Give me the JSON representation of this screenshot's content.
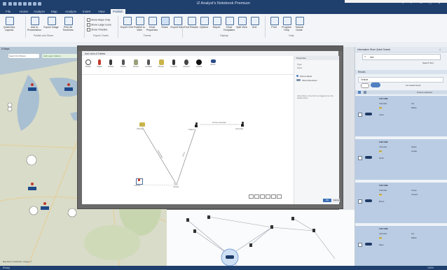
{
  "window": {
    "title": "i2 Analyst's Notebook Premium"
  },
  "menu": {
    "tabs": [
      "File",
      "Home",
      "Analyze",
      "Map",
      "Analyze",
      "Insert",
      "View",
      "Publish"
    ],
    "active_index": 7
  },
  "ribbon": {
    "groups": [
      "Analysis",
      "Publish and Share",
      "Export Charts",
      "Theme",
      "Display",
      "Help"
    ],
    "buttons": [
      "Quickview Layouts",
      "Add to Presentation",
      "Export Image",
      "Print All Timelines",
      "Export Grid",
      "Publish to Web",
      "Chart Properties",
      "Share",
      "Export Data",
      "Find Results",
      "Options",
      "Report",
      "Chart Templates",
      "Split View",
      "Grid",
      "Print",
      "Program Help",
      "Tutorial Guide"
    ],
    "checkboxes": [
      "Show Maps Only",
      "Show Large Icons",
      "Show Timeline"
    ]
  },
  "map": {
    "title": "i2 Maps",
    "search_label": "Search for Places",
    "layer_label": "Add Layer Options",
    "attribution": "Map data © contributors, Imagery ©"
  },
  "dialog": {
    "tabs": [
      "Add Links & Entities"
    ],
    "palette": [
      "Person",
      "Object",
      "Vehicle",
      "Phone",
      "Person",
      "Location",
      "Person",
      "Location",
      "Account",
      "Vehicle",
      "Event"
    ],
    "nodes": [
      {
        "label": "Vehicle"
      },
      {
        "label": "Subject"
      },
      {
        "label": "Associate"
      },
      {
        "label": "Address"
      },
      {
        "label": "Location"
      }
    ],
    "link_labels": [
      "Associated",
      "Drove",
      "Known Associate"
    ],
    "props": {
      "header": "Properties",
      "field1": "Type",
      "field2": "Card",
      "opt1": "Show Labels",
      "opt2": "Show Directions",
      "help_text": "Add entities to the chart by dragging from the palette above."
    },
    "ok_label": "OK",
    "cancel_label": "Cancel"
  },
  "right_panel": {
    "title": "Information Store Quick Search",
    "search_value": "red",
    "search_label": "Search Text",
    "results_label": "Results",
    "filter_label": "Vehicle",
    "count_label": "12 results found",
    "page_label": "6 items selected",
    "results": [
      {
        "id": "1234 VWB",
        "make": "Chevrolet",
        "colour": "red",
        "model": "Malibu",
        "type": "Car",
        "owner": "Jones"
      },
      {
        "id": "1239 VWB",
        "make": "Chevrolet",
        "colour": "red",
        "model": "Impala",
        "type": "Sedan",
        "owner": "Smith"
      },
      {
        "id": "1240 VWB",
        "make": "Chevrolet",
        "colour": "red",
        "model": "Camaro",
        "type": "Coupe",
        "owner": "Brown"
      },
      {
        "id": "1245 VWB",
        "make": "Chevrolet",
        "colour": "red",
        "model": "Malibu",
        "type": "Car",
        "owner": "Davis"
      }
    ]
  },
  "status": {
    "left": "Ready",
    "right": "100%"
  }
}
